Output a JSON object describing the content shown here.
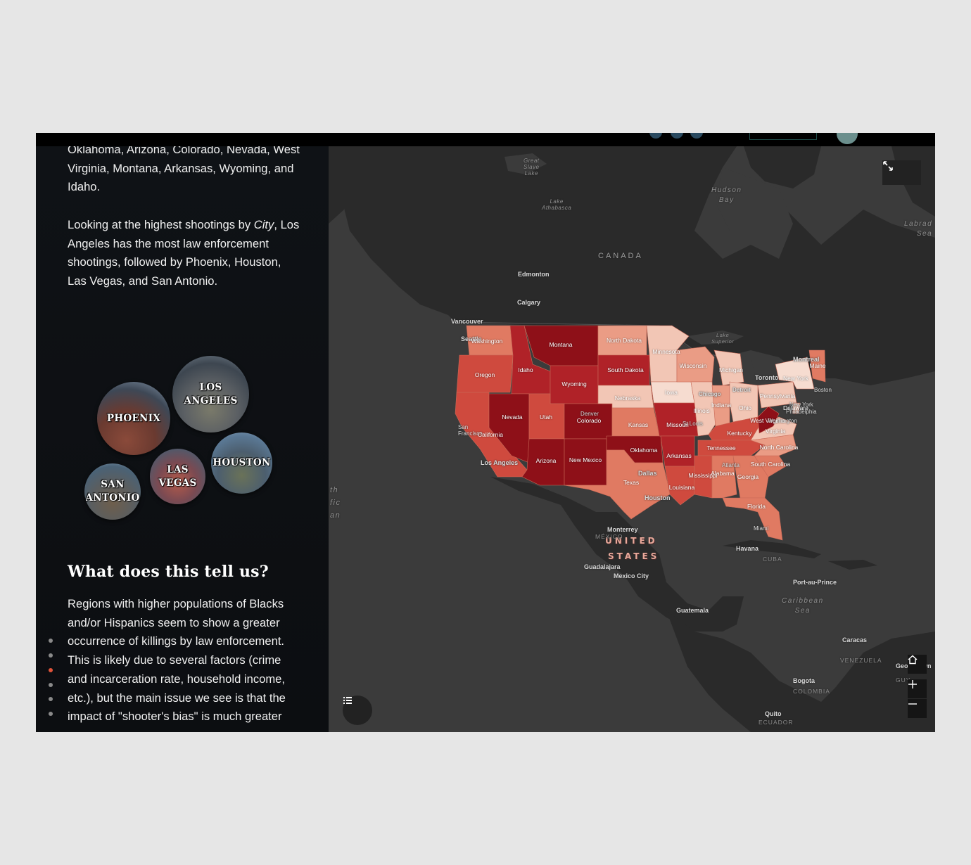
{
  "panel": {
    "paragraph1": "Oklahoma, Arizona, Colorado, Nevada, West Virginia, Montana, Arkansas, Wyoming, and Idaho.",
    "paragraph2_before": "Looking at the highest shootings by ",
    "paragraph2_em": "City",
    "paragraph2_after": ", Los Angeles has the most law enforcement shootings, followed by Phoenix, Houston, Las Vegas, and San Antonio.",
    "heading": "What does this tell us?",
    "paragraph3": "Regions with higher populations of Blacks and/or Hispanics seem to show a greater occurrence of killings by law enforcement. This is likely due to several factors (crime and incarceration rate, household income, etc.), but the main issue we see is that the impact of \"shooter's bias\" is much greater",
    "cities": [
      {
        "line1": "LOS",
        "line2": "ANGELES"
      },
      {
        "line1": "PHOENIX",
        "line2": ""
      },
      {
        "line1": "HOUSTON",
        "line2": ""
      },
      {
        "line1": "LAS",
        "line2": "VEGAS"
      },
      {
        "line1": "SAN",
        "line2": "ANTONIO"
      }
    ],
    "nav_dots": 6,
    "active_dot": 2
  },
  "map": {
    "colors": {
      "darkest": "#8e1018",
      "dark": "#b02228",
      "mid": "#cf4a3e",
      "light": "#e07a62",
      "lighter": "#ea9c85",
      "lightest": "#f2c6b5",
      "palest": "#f6dcd0"
    },
    "water_labels": {
      "great_slave": "Great\nSlave\nLake",
      "athabasca": "Lake\nAthabasca",
      "hudson": "Hudson\nBay",
      "labrador": "Labrad\nSea",
      "superior": "Lake\nSuperior",
      "pacific": "th\nfic\nan",
      "caribbean": "Caribbean\nSea"
    },
    "country_labels": {
      "canada": "CANADA",
      "us1": "UNITED",
      "us2": "STATES",
      "mexico": "MÉXICO",
      "cuba": "CUBA",
      "venezuela": "VENEZUELA",
      "colombia": "COLOMBIA",
      "ecuador": "ECUADOR",
      "guy": "GUY"
    },
    "cities": {
      "edmonton": "Edmonton",
      "calgary": "Calgary",
      "vancouver": "Vancouver",
      "seattle": "Seattle",
      "montreal": "Montreal",
      "toronto": "Toronto",
      "boston": "Boston",
      "newyork": "New York",
      "philadelphia": "Philadelphia",
      "washington": "Washington",
      "detroit": "Detroit",
      "chicago": "Chicago",
      "stlouis": "St Louis",
      "denver": "Denver",
      "sanfrancisco": "San\nFrancisco",
      "losangeles": "Los Angeles",
      "dallas": "Dallas",
      "houston": "Houston",
      "atlanta": "Atlanta",
      "miami": "Miami",
      "monterrey": "Monterrey",
      "guadalajara": "Guadalajara",
      "mexicocity": "Mexico City",
      "havana": "Havana",
      "guatemala": "Guatemala",
      "portauprince": "Port-au-Prince",
      "caracas": "Caracas",
      "bogota": "Bogota",
      "quito": "Quito",
      "geo": "Geo",
      "wn": "wn"
    },
    "states": [
      {
        "name": "Washington",
        "tone": "light"
      },
      {
        "name": "Oregon",
        "tone": "mid"
      },
      {
        "name": "California",
        "tone": "mid"
      },
      {
        "name": "Idaho",
        "tone": "dark"
      },
      {
        "name": "Nevada",
        "tone": "darkest"
      },
      {
        "name": "Montana",
        "tone": "darkest"
      },
      {
        "name": "Wyoming",
        "tone": "dark"
      },
      {
        "name": "Utah",
        "tone": "mid"
      },
      {
        "name": "Arizona",
        "tone": "darkest"
      },
      {
        "name": "Colorado",
        "tone": "darkest"
      },
      {
        "name": "New Mexico",
        "tone": "darkest"
      },
      {
        "name": "North Dakota",
        "tone": "lighter"
      },
      {
        "name": "South Dakota",
        "tone": "dark"
      },
      {
        "name": "Nebraska",
        "tone": "lightest"
      },
      {
        "name": "Kansas",
        "tone": "light"
      },
      {
        "name": "Oklahoma",
        "tone": "darkest"
      },
      {
        "name": "Texas",
        "tone": "light"
      },
      {
        "name": "Minnesota",
        "tone": "lightest"
      },
      {
        "name": "Iowa",
        "tone": "palest"
      },
      {
        "name": "Missouri",
        "tone": "dark"
      },
      {
        "name": "Arkansas",
        "tone": "dark"
      },
      {
        "name": "Louisiana",
        "tone": "mid"
      },
      {
        "name": "Wisconsin",
        "tone": "lighter"
      },
      {
        "name": "Illinois",
        "tone": "lightest"
      },
      {
        "name": "Michigan",
        "tone": "lightest"
      },
      {
        "name": "Indiana",
        "tone": "lighter"
      },
      {
        "name": "Ohio",
        "tone": "lightest"
      },
      {
        "name": "Kentucky",
        "tone": "mid"
      },
      {
        "name": "Tennessee",
        "tone": "mid"
      },
      {
        "name": "Mississippi",
        "tone": "mid"
      },
      {
        "name": "Alabama",
        "tone": "light"
      },
      {
        "name": "Georgia",
        "tone": "light"
      },
      {
        "name": "Florida",
        "tone": "light"
      },
      {
        "name": "South Carolina",
        "tone": "light"
      },
      {
        "name": "North Carolina",
        "tone": "lighter"
      },
      {
        "name": "Virginia",
        "tone": "lightest"
      },
      {
        "name": "West Virginia",
        "tone": "darkest"
      },
      {
        "name": "Pennsylvania",
        "tone": "lightest"
      },
      {
        "name": "New York",
        "tone": "palest"
      },
      {
        "name": "Maine",
        "tone": "light"
      },
      {
        "name": "Delaware",
        "tone": "lightest"
      }
    ]
  }
}
